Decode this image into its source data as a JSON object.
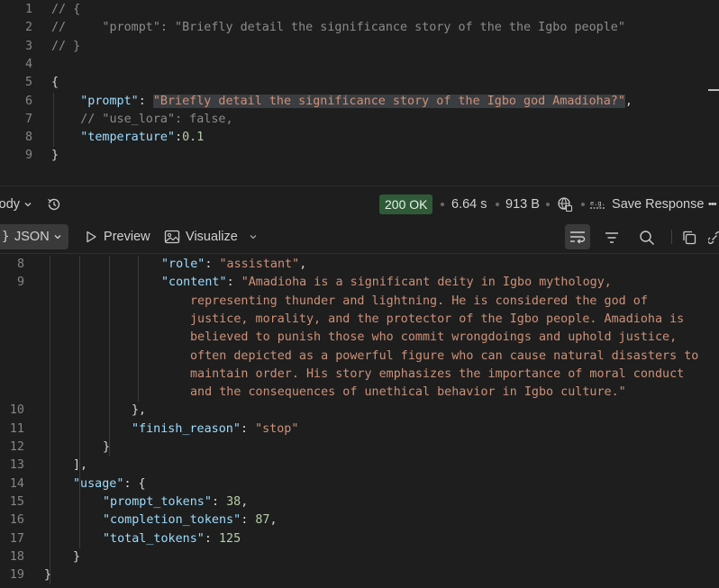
{
  "editor": {
    "lines": [
      {
        "n": "1",
        "segs": [
          {
            "t": "// {",
            "c": "c-comg"
          }
        ]
      },
      {
        "n": "2",
        "segs": [
          {
            "t": "//     \"prompt\": \"Briefly detail the significance story of the the Igbo people\"",
            "c": "c-comg"
          }
        ]
      },
      {
        "n": "3",
        "segs": [
          {
            "t": "// }",
            "c": "c-comg"
          }
        ]
      },
      {
        "n": "4",
        "segs": []
      },
      {
        "n": "5",
        "segs": [
          {
            "t": "{",
            "c": "c-pun"
          }
        ]
      },
      {
        "n": "6",
        "segs": [
          {
            "t": "    ",
            "c": ""
          },
          {
            "t": "\"prompt\"",
            "c": "c-key"
          },
          {
            "t": ": ",
            "c": "c-pun"
          },
          {
            "t": "\"Briefly detail the significance story of the Igbo god Amadioha?\"",
            "c": "c-str hl"
          },
          {
            "t": ",",
            "c": "c-pun"
          }
        ]
      },
      {
        "n": "7",
        "segs": [
          {
            "t": "    ",
            "c": ""
          },
          {
            "t": "// \"use_lora\": false,",
            "c": "c-comg"
          }
        ]
      },
      {
        "n": "8",
        "segs": [
          {
            "t": "    ",
            "c": ""
          },
          {
            "t": "\"temperature\"",
            "c": "c-key"
          },
          {
            "t": ":",
            "c": "c-pun"
          },
          {
            "t": "0.1",
            "c": "c-num"
          }
        ]
      },
      {
        "n": "9",
        "segs": [
          {
            "t": "}",
            "c": "c-pun"
          }
        ]
      }
    ]
  },
  "response_bar": {
    "body_label": "Body",
    "status": "200 OK",
    "time": "6.64 s",
    "size": "913 B",
    "save_label": "Save Response",
    "more": "•••"
  },
  "tool_bar": {
    "json_label": "JSON",
    "preview_label": "Preview",
    "visualize_label": "Visualize"
  },
  "response": {
    "lines": [
      {
        "n": "8",
        "indent": 179,
        "segs": [
          {
            "t": "\"role\"",
            "c": "c-key"
          },
          {
            "t": ": ",
            "c": "c-pun"
          },
          {
            "t": "\"assistant\"",
            "c": "c-str"
          },
          {
            "t": ",",
            "c": "c-pun"
          }
        ]
      },
      {
        "n": "9",
        "indent": 179,
        "segs": [
          {
            "t": "\"content\"",
            "c": "c-key"
          },
          {
            "t": ": ",
            "c": "c-pun"
          },
          {
            "t": "\"Amadioha is a significant deity in Igbo mythology,",
            "c": "c-str"
          }
        ]
      },
      {
        "n": "",
        "indent": 211,
        "segs": [
          {
            "t": "representing thunder and lightning. He is considered the god of",
            "c": "c-str"
          }
        ]
      },
      {
        "n": "",
        "indent": 211,
        "segs": [
          {
            "t": "justice, morality, and the protector of the Igbo people. Amadioha is",
            "c": "c-str"
          }
        ]
      },
      {
        "n": "",
        "indent": 211,
        "segs": [
          {
            "t": "believed to punish those who commit wrongdoings and uphold justice,",
            "c": "c-str"
          }
        ]
      },
      {
        "n": "",
        "indent": 211,
        "segs": [
          {
            "t": "often depicted as a powerful figure who can cause natural disasters to",
            "c": "c-str"
          }
        ]
      },
      {
        "n": "",
        "indent": 211,
        "segs": [
          {
            "t": "maintain order. His story emphasizes the importance of moral conduct",
            "c": "c-str"
          }
        ]
      },
      {
        "n": "",
        "indent": 211,
        "segs": [
          {
            "t": "and the consequences of unethical behavior in Igbo culture.\"",
            "c": "c-str"
          }
        ]
      },
      {
        "n": "10",
        "indent": 146,
        "segs": [
          {
            "t": "},",
            "c": "c-pun"
          }
        ]
      },
      {
        "n": "11",
        "indent": 146,
        "segs": [
          {
            "t": "\"finish_reason\"",
            "c": "c-key"
          },
          {
            "t": ": ",
            "c": "c-pun"
          },
          {
            "t": "\"stop\"",
            "c": "c-str"
          }
        ]
      },
      {
        "n": "12",
        "indent": 114,
        "segs": [
          {
            "t": "}",
            "c": "c-pun"
          }
        ]
      },
      {
        "n": "13",
        "indent": 81,
        "segs": [
          {
            "t": "],",
            "c": "c-pun"
          }
        ]
      },
      {
        "n": "14",
        "indent": 81,
        "segs": [
          {
            "t": "\"usage\"",
            "c": "c-key"
          },
          {
            "t": ": {",
            "c": "c-pun"
          }
        ]
      },
      {
        "n": "15",
        "indent": 114,
        "segs": [
          {
            "t": "\"prompt_tokens\"",
            "c": "c-key"
          },
          {
            "t": ": ",
            "c": "c-pun"
          },
          {
            "t": "38",
            "c": "c-num"
          },
          {
            "t": ",",
            "c": "c-pun"
          }
        ]
      },
      {
        "n": "16",
        "indent": 114,
        "segs": [
          {
            "t": "\"completion_tokens\"",
            "c": "c-key"
          },
          {
            "t": ": ",
            "c": "c-pun"
          },
          {
            "t": "87",
            "c": "c-num"
          },
          {
            "t": ",",
            "c": "c-pun"
          }
        ]
      },
      {
        "n": "17",
        "indent": 114,
        "segs": [
          {
            "t": "\"total_tokens\"",
            "c": "c-key"
          },
          {
            "t": ": ",
            "c": "c-pun"
          },
          {
            "t": "125",
            "c": "c-num"
          }
        ]
      },
      {
        "n": "18",
        "indent": 81,
        "segs": [
          {
            "t": "}",
            "c": "c-pun"
          }
        ]
      },
      {
        "n": "19",
        "indent": 49,
        "segs": [
          {
            "t": "}",
            "c": "c-pun"
          }
        ]
      }
    ]
  },
  "icons": {
    "history": "history-icon",
    "network": "network-icon",
    "save": "save-response-icon",
    "wrap": "wrap-lines-icon",
    "filter": "filter-icon",
    "search": "search-icon",
    "copy": "copy-icon",
    "link": "link-icon"
  }
}
